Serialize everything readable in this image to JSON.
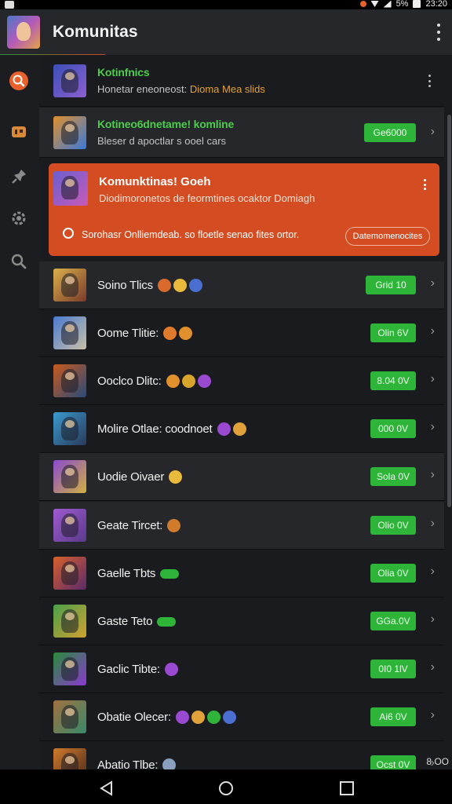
{
  "status_bar": {
    "time": "23:20",
    "battery": "5%"
  },
  "app_bar": {
    "title": "Komunitas",
    "logo_icon": "game-avatar-icon",
    "menu_icon": "more-vert-icon"
  },
  "side_rail": {
    "items": [
      {
        "icon": "search-orange-icon",
        "color": "#e8602c"
      },
      {
        "icon": "controller-icon",
        "color": "#d8893a"
      },
      {
        "icon": "pin-icon",
        "color": "#8a8a8a"
      },
      {
        "icon": "settings-gear-icon",
        "color": "#8a8a8a"
      },
      {
        "icon": "search-icon",
        "color": "#8a8a8a"
      }
    ]
  },
  "rows_top": [
    {
      "title": "Kotinfnics",
      "subtitle_prefix": "Honetar eneoneost:",
      "subtitle_highlight": "Dioma Mea slids",
      "style": "green"
    },
    {
      "title": "Kotineo6dnetame! komline",
      "subtitle": "Bleser d apoctlar s ooel cars",
      "button": "Ge6000",
      "style": "green"
    }
  ],
  "highlight_card": {
    "title": "Komunktinas! Goeh",
    "subtitle": "Diodimoronetos de feormtines ocaktor Domiagh",
    "note": "Sorohasr Onlliemdeab. so floetle senao fites ortor.",
    "button": "Datemomenocites"
  },
  "rows": [
    {
      "title": "Soino Tlics",
      "button": "Grid 10",
      "emojis": [
        "#d96a2c",
        "#e8b93a",
        "#4a6fd0"
      ]
    },
    {
      "title": "Oome Tlitie:",
      "button": "Olin 6V",
      "emojis": [
        "#e07a2c",
        "#e0902c"
      ]
    },
    {
      "title": "Ooclco Dlitc:",
      "button": "8.04 0V",
      "emojis": [
        "#e0902c",
        "#d8a52c",
        "#9a4ad0"
      ]
    },
    {
      "title": "Molire Otlae: coodnoet",
      "button": "000 0V",
      "emojis": [
        "#9a4ad0",
        "#e0a03a"
      ]
    },
    {
      "title": "Uodie Oivaer",
      "button": "Sola 0V",
      "emojis": [
        "#e8b93a"
      ]
    },
    {
      "title": "Geate Tircet:",
      "button": "Olio 0V",
      "emojis": [
        "#d07a2c"
      ]
    },
    {
      "title": "Gaelle Tbts",
      "button": "Olia 0V",
      "emojis": [
        "pill:#2fb43a"
      ]
    },
    {
      "title": "Gaste Teto",
      "button": "GGa.0V",
      "emojis": [
        "pill:#2fb43a"
      ]
    },
    {
      "title": "Gaclic Tibte:",
      "button": "0I0 1lV",
      "emojis": [
        "#9a4ad0"
      ]
    },
    {
      "title": "Obatie Olecer:",
      "button": "Ai6 0V",
      "emojis": [
        "#9a4ad0",
        "#e0a03a",
        "#2fb43a",
        "#4a6fd0"
      ]
    },
    {
      "title": "Abatio Tlbe:",
      "button": "Ocst 0V",
      "emojis": [
        "#8aa0c0"
      ]
    }
  ],
  "overflow_text": "8 OO",
  "thumb_colors": [
    [
      "#3b4fb8",
      "#8c5fd0"
    ],
    [
      "#e0902c",
      "#3b7ad8"
    ],
    [
      "#6b5fd0",
      "#c85ab8"
    ],
    [
      "#d9b04a",
      "#7a3a2a"
    ],
    [
      "#4a7ad0",
      "#c9c0a8"
    ],
    [
      "#c85a1c",
      "#2a4a7a"
    ],
    [
      "#3a9ad0",
      "#2a3a5a"
    ],
    [
      "#8a4ad0",
      "#d0b040"
    ],
    [
      "#a05ad0",
      "#5a3a8a"
    ],
    [
      "#d8602c",
      "#5a2a6a"
    ],
    [
      "#4aa04a",
      "#d0a030"
    ],
    [
      "#2a8a3a",
      "#8a3ad0"
    ],
    [
      "#a07040",
      "#3a8a6a"
    ],
    [
      "#d07a2c",
      "#4a2a1a"
    ]
  ],
  "nav_bar": {
    "back_icon": "back-triangle-icon",
    "home_icon": "home-circle-icon",
    "recents_icon": "recents-square-icon"
  }
}
